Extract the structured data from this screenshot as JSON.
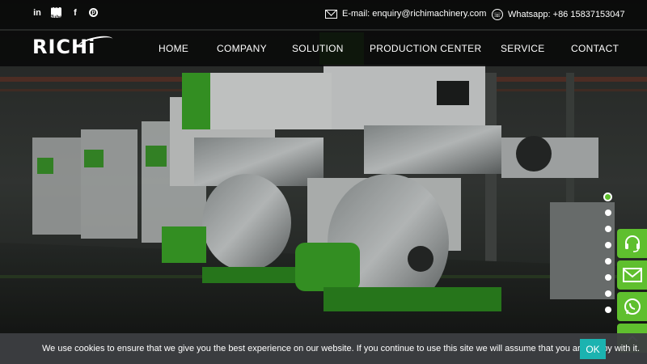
{
  "topbar": {
    "social": [
      "in",
      "You Tube",
      "f",
      "p"
    ],
    "email_label": "E-mail: enquiry@richimachinery.com",
    "whatsapp_label": "Whatsapp: +86 15837153047"
  },
  "logo": "RICHi",
  "nav": {
    "items": [
      "HOME",
      "COMPANY",
      "SOLUTION",
      "PRODUCTION CENTER",
      "SERVICE",
      "CONTACT"
    ]
  },
  "slider": {
    "slides": 8,
    "active_index": 0
  },
  "side_buttons": [
    "headset-icon",
    "mail-icon",
    "whatsapp-icon",
    "up-arrow-icon"
  ],
  "cookie": {
    "text": "We use cookies to ensure that we give you the best experience on our website. If you continue to use this site we will assume that you are happy with it.",
    "ok_label": "OK"
  },
  "colors": {
    "accent": "#5fbf2e",
    "ok_button": "#1bb3b0",
    "bar": "#0a0a0a"
  }
}
